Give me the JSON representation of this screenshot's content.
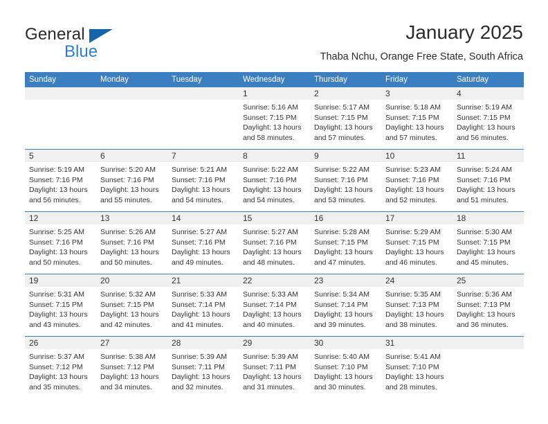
{
  "brand": {
    "name_top": "General",
    "name_bottom": "Blue",
    "accent_color": "#1464aa",
    "blue_text_color": "#2a7fd4"
  },
  "header": {
    "title": "January 2025",
    "subtitle": "Thaba Nchu, Orange Free State, South Africa"
  },
  "calendar": {
    "header_bg": "#3c7fc1",
    "daynum_bg": "#f0f0f0",
    "weekday_names": [
      "Sunday",
      "Monday",
      "Tuesday",
      "Wednesday",
      "Thursday",
      "Friday",
      "Saturday"
    ],
    "weeks": [
      [
        {
          "day": "",
          "sunrise": "",
          "sunset": "",
          "daylight1": "",
          "daylight2": "",
          "empty": true
        },
        {
          "day": "",
          "sunrise": "",
          "sunset": "",
          "daylight1": "",
          "daylight2": "",
          "empty": true
        },
        {
          "day": "",
          "sunrise": "",
          "sunset": "",
          "daylight1": "",
          "daylight2": "",
          "empty": true
        },
        {
          "day": "1",
          "sunrise": "Sunrise: 5:16 AM",
          "sunset": "Sunset: 7:15 PM",
          "daylight1": "Daylight: 13 hours",
          "daylight2": "and 58 minutes."
        },
        {
          "day": "2",
          "sunrise": "Sunrise: 5:17 AM",
          "sunset": "Sunset: 7:15 PM",
          "daylight1": "Daylight: 13 hours",
          "daylight2": "and 57 minutes."
        },
        {
          "day": "3",
          "sunrise": "Sunrise: 5:18 AM",
          "sunset": "Sunset: 7:15 PM",
          "daylight1": "Daylight: 13 hours",
          "daylight2": "and 57 minutes."
        },
        {
          "day": "4",
          "sunrise": "Sunrise: 5:19 AM",
          "sunset": "Sunset: 7:15 PM",
          "daylight1": "Daylight: 13 hours",
          "daylight2": "and 56 minutes."
        }
      ],
      [
        {
          "day": "5",
          "sunrise": "Sunrise: 5:19 AM",
          "sunset": "Sunset: 7:16 PM",
          "daylight1": "Daylight: 13 hours",
          "daylight2": "and 56 minutes."
        },
        {
          "day": "6",
          "sunrise": "Sunrise: 5:20 AM",
          "sunset": "Sunset: 7:16 PM",
          "daylight1": "Daylight: 13 hours",
          "daylight2": "and 55 minutes."
        },
        {
          "day": "7",
          "sunrise": "Sunrise: 5:21 AM",
          "sunset": "Sunset: 7:16 PM",
          "daylight1": "Daylight: 13 hours",
          "daylight2": "and 54 minutes."
        },
        {
          "day": "8",
          "sunrise": "Sunrise: 5:22 AM",
          "sunset": "Sunset: 7:16 PM",
          "daylight1": "Daylight: 13 hours",
          "daylight2": "and 54 minutes."
        },
        {
          "day": "9",
          "sunrise": "Sunrise: 5:22 AM",
          "sunset": "Sunset: 7:16 PM",
          "daylight1": "Daylight: 13 hours",
          "daylight2": "and 53 minutes."
        },
        {
          "day": "10",
          "sunrise": "Sunrise: 5:23 AM",
          "sunset": "Sunset: 7:16 PM",
          "daylight1": "Daylight: 13 hours",
          "daylight2": "and 52 minutes."
        },
        {
          "day": "11",
          "sunrise": "Sunrise: 5:24 AM",
          "sunset": "Sunset: 7:16 PM",
          "daylight1": "Daylight: 13 hours",
          "daylight2": "and 51 minutes."
        }
      ],
      [
        {
          "day": "12",
          "sunrise": "Sunrise: 5:25 AM",
          "sunset": "Sunset: 7:16 PM",
          "daylight1": "Daylight: 13 hours",
          "daylight2": "and 50 minutes."
        },
        {
          "day": "13",
          "sunrise": "Sunrise: 5:26 AM",
          "sunset": "Sunset: 7:16 PM",
          "daylight1": "Daylight: 13 hours",
          "daylight2": "and 50 minutes."
        },
        {
          "day": "14",
          "sunrise": "Sunrise: 5:27 AM",
          "sunset": "Sunset: 7:16 PM",
          "daylight1": "Daylight: 13 hours",
          "daylight2": "and 49 minutes."
        },
        {
          "day": "15",
          "sunrise": "Sunrise: 5:27 AM",
          "sunset": "Sunset: 7:16 PM",
          "daylight1": "Daylight: 13 hours",
          "daylight2": "and 48 minutes."
        },
        {
          "day": "16",
          "sunrise": "Sunrise: 5:28 AM",
          "sunset": "Sunset: 7:15 PM",
          "daylight1": "Daylight: 13 hours",
          "daylight2": "and 47 minutes."
        },
        {
          "day": "17",
          "sunrise": "Sunrise: 5:29 AM",
          "sunset": "Sunset: 7:15 PM",
          "daylight1": "Daylight: 13 hours",
          "daylight2": "and 46 minutes."
        },
        {
          "day": "18",
          "sunrise": "Sunrise: 5:30 AM",
          "sunset": "Sunset: 7:15 PM",
          "daylight1": "Daylight: 13 hours",
          "daylight2": "and 45 minutes."
        }
      ],
      [
        {
          "day": "19",
          "sunrise": "Sunrise: 5:31 AM",
          "sunset": "Sunset: 7:15 PM",
          "daylight1": "Daylight: 13 hours",
          "daylight2": "and 43 minutes."
        },
        {
          "day": "20",
          "sunrise": "Sunrise: 5:32 AM",
          "sunset": "Sunset: 7:15 PM",
          "daylight1": "Daylight: 13 hours",
          "daylight2": "and 42 minutes."
        },
        {
          "day": "21",
          "sunrise": "Sunrise: 5:33 AM",
          "sunset": "Sunset: 7:14 PM",
          "daylight1": "Daylight: 13 hours",
          "daylight2": "and 41 minutes."
        },
        {
          "day": "22",
          "sunrise": "Sunrise: 5:33 AM",
          "sunset": "Sunset: 7:14 PM",
          "daylight1": "Daylight: 13 hours",
          "daylight2": "and 40 minutes."
        },
        {
          "day": "23",
          "sunrise": "Sunrise: 5:34 AM",
          "sunset": "Sunset: 7:14 PM",
          "daylight1": "Daylight: 13 hours",
          "daylight2": "and 39 minutes."
        },
        {
          "day": "24",
          "sunrise": "Sunrise: 5:35 AM",
          "sunset": "Sunset: 7:13 PM",
          "daylight1": "Daylight: 13 hours",
          "daylight2": "and 38 minutes."
        },
        {
          "day": "25",
          "sunrise": "Sunrise: 5:36 AM",
          "sunset": "Sunset: 7:13 PM",
          "daylight1": "Daylight: 13 hours",
          "daylight2": "and 36 minutes."
        }
      ],
      [
        {
          "day": "26",
          "sunrise": "Sunrise: 5:37 AM",
          "sunset": "Sunset: 7:12 PM",
          "daylight1": "Daylight: 13 hours",
          "daylight2": "and 35 minutes."
        },
        {
          "day": "27",
          "sunrise": "Sunrise: 5:38 AM",
          "sunset": "Sunset: 7:12 PM",
          "daylight1": "Daylight: 13 hours",
          "daylight2": "and 34 minutes."
        },
        {
          "day": "28",
          "sunrise": "Sunrise: 5:39 AM",
          "sunset": "Sunset: 7:11 PM",
          "daylight1": "Daylight: 13 hours",
          "daylight2": "and 32 minutes."
        },
        {
          "day": "29",
          "sunrise": "Sunrise: 5:39 AM",
          "sunset": "Sunset: 7:11 PM",
          "daylight1": "Daylight: 13 hours",
          "daylight2": "and 31 minutes."
        },
        {
          "day": "30",
          "sunrise": "Sunrise: 5:40 AM",
          "sunset": "Sunset: 7:10 PM",
          "daylight1": "Daylight: 13 hours",
          "daylight2": "and 30 minutes."
        },
        {
          "day": "31",
          "sunrise": "Sunrise: 5:41 AM",
          "sunset": "Sunset: 7:10 PM",
          "daylight1": "Daylight: 13 hours",
          "daylight2": "and 28 minutes."
        },
        {
          "day": "",
          "sunrise": "",
          "sunset": "",
          "daylight1": "",
          "daylight2": "",
          "empty": true
        }
      ]
    ]
  }
}
